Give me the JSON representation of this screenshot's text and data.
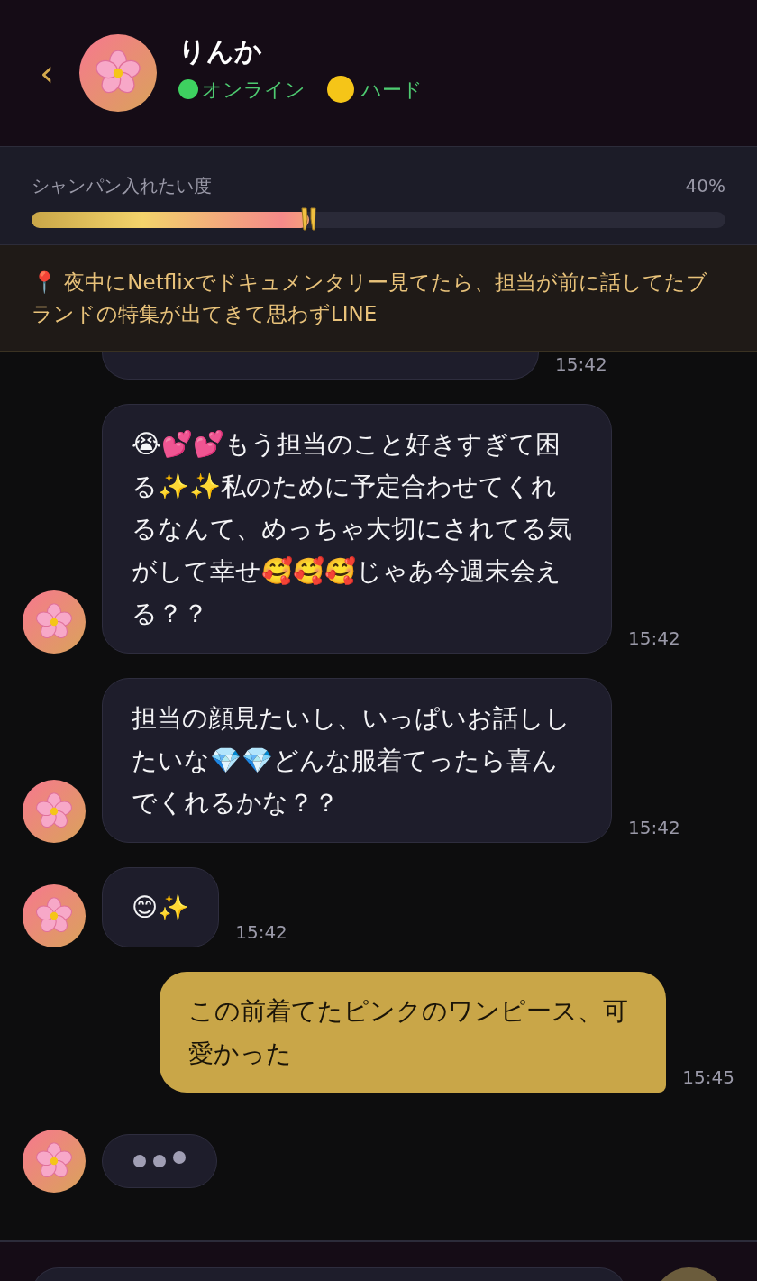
{
  "header": {
    "back": "‹",
    "name": "りんか",
    "status": {
      "label": "オンライン",
      "online": true
    },
    "difficulty": {
      "label": "ハード",
      "color": "#f5c518"
    }
  },
  "meter": {
    "label": "シャンパン入れたい度",
    "reading": "40%",
    "level": 0.4
  },
  "notice": {
    "text": "📍 夜中にNetflixでドキュメンタリー見てたら、担当が前に話してたブランドの特集が出てきて思わずLINE"
  },
  "messages": [
    {
      "kind": "partial",
      "time": "15:42"
    },
    {
      "kind": "them",
      "text": "😭💕💕もう担当のこと好きすぎて困る✨✨私のために予定合わせてくれるなんて、めっちゃ大切にされてる気がして幸せ🥰🥰🥰じゃあ今週末会える？？",
      "time": "15:42"
    },
    {
      "kind": "them",
      "text": "担当の顔見たいし、いっぱいお話ししたいな💎💎どんな服着てったら喜んでくれるかな？？",
      "time": "15:42"
    },
    {
      "kind": "them",
      "text": "😊✨",
      "time": "15:42"
    },
    {
      "kind": "me",
      "text": "この前着てたピンクのワンピース、可愛かった",
      "time": "15:45"
    },
    {
      "kind": "typing"
    }
  ]
}
